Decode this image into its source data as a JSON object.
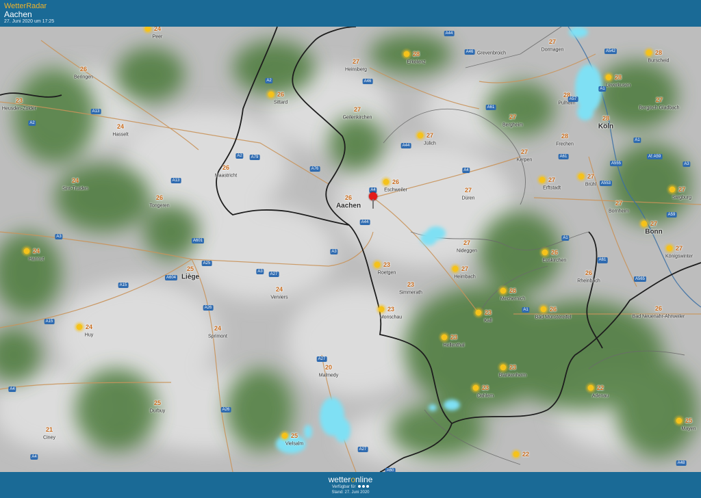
{
  "header": {
    "brand": "WetterRadar",
    "location": "Aachen",
    "timestamp": "27. Juni 2020 um 17:25"
  },
  "footer": {
    "logo_a": "wetter",
    "logo_o": "o",
    "logo_b": "nline",
    "availability": "Verfügbar für",
    "stand": "Stand: 27. Juni 2020"
  },
  "colors": {
    "bar": "#1a6a96",
    "accent": "#f1b42a",
    "forest": "#4b7a3a",
    "rain": "#7fe0f4",
    "temperature": "#c86a1a"
  },
  "places": [
    {
      "name": "Peer",
      "temp": "24",
      "sun": true
    },
    {
      "name": "Beringen",
      "temp": "26"
    },
    {
      "name": "Heusden-Zolder",
      "temp": "23"
    },
    {
      "name": "Hasselt",
      "temp": "24"
    },
    {
      "name": "Sint-Truiden",
      "temp": "24"
    },
    {
      "name": "Tongeren",
      "temp": "26"
    },
    {
      "name": "Hannut",
      "temp": "24",
      "sun": true
    },
    {
      "name": "Liège",
      "temp": "25",
      "big": true
    },
    {
      "name": "Huy",
      "temp": "24",
      "sun": true
    },
    {
      "name": "Ciney",
      "temp": "21"
    },
    {
      "name": "Durbuy",
      "temp": "25"
    },
    {
      "name": "Sprimont",
      "temp": "24"
    },
    {
      "name": "Verviers",
      "temp": "24"
    },
    {
      "name": "Maastricht",
      "temp": "26"
    },
    {
      "name": "Sittard",
      "temp": "26",
      "sun": true
    },
    {
      "name": "Heinsberg",
      "temp": "27"
    },
    {
      "name": "Geilenkirchen",
      "temp": "27"
    },
    {
      "name": "Erkelenz",
      "temp": "28",
      "sun": true
    },
    {
      "name": "Grevenbroich"
    },
    {
      "name": "Dormagen",
      "temp": "27"
    },
    {
      "name": "Leverkusen",
      "temp": "28",
      "sun": true
    },
    {
      "name": "Burscheid",
      "temp": "28",
      "sun": true
    },
    {
      "name": "Pulheim",
      "temp": "28"
    },
    {
      "name": "Bergisch Gladbach",
      "temp": "27"
    },
    {
      "name": "Köln",
      "temp": "28",
      "big": true
    },
    {
      "name": "Bergheim",
      "temp": "27"
    },
    {
      "name": "Jülich",
      "temp": "27",
      "sun": true
    },
    {
      "name": "Frechen",
      "temp": "28"
    },
    {
      "name": "Kerpen",
      "temp": "27"
    },
    {
      "name": "Eschweiler",
      "temp": "26",
      "sun": true
    },
    {
      "name": "Aachen",
      "temp": "26",
      "big": true
    },
    {
      "name": "Düren",
      "temp": "27"
    },
    {
      "name": "Erftstadt",
      "temp": "27",
      "sun": true
    },
    {
      "name": "Brühl",
      "temp": "27",
      "sun": true
    },
    {
      "name": "Siegburg",
      "temp": "27",
      "sun": true
    },
    {
      "name": "Bornheim",
      "temp": "27"
    },
    {
      "name": "Bonn",
      "temp": "27",
      "big": true,
      "sun": true
    },
    {
      "name": "Königswinter",
      "temp": "27",
      "sun": true
    },
    {
      "name": "Nideggen",
      "temp": "27"
    },
    {
      "name": "Euskirchen",
      "temp": "26",
      "sun": true
    },
    {
      "name": "Heimbach",
      "temp": "27",
      "sun": true
    },
    {
      "name": "Roetgen",
      "temp": "23",
      "sun": true
    },
    {
      "name": "Simmerath",
      "temp": "23"
    },
    {
      "name": "Monschau",
      "temp": "23",
      "sun": true
    },
    {
      "name": "Rheinbach",
      "temp": "26"
    },
    {
      "name": "Mechernich",
      "temp": "26",
      "sun": true
    },
    {
      "name": "Kall",
      "temp": "23",
      "sun": true
    },
    {
      "name": "Bad Münstereifel",
      "temp": "26",
      "sun": true
    },
    {
      "name": "Bad Neuenahr-Ahrweiler",
      "temp": "26"
    },
    {
      "name": "Hellenthal",
      "temp": "23",
      "sun": true
    },
    {
      "name": "Blankenheim",
      "temp": "23",
      "sun": true
    },
    {
      "name": "Dahlem",
      "temp": "23",
      "sun": true
    },
    {
      "name": "Adenau",
      "temp": "22",
      "sun": true
    },
    {
      "name": "Mayen",
      "temp": "25",
      "sun": true
    },
    {
      "name": "Malmedy",
      "temp": "20"
    },
    {
      "name": "Vielsalm",
      "temp": "25",
      "sun": true
    },
    {
      "name": "",
      "temp": "22",
      "sun": true
    }
  ],
  "roads": [
    "A2",
    "A13",
    "A2",
    "A13",
    "A15",
    "A3",
    "A601",
    "A25",
    "A604",
    "A15",
    "A26",
    "A26",
    "A27",
    "A4",
    "A3",
    "A27",
    "A2",
    "A79",
    "A76",
    "A44",
    "A4",
    "A44",
    "A3",
    "A27",
    "A46",
    "A61",
    "A46",
    "A44",
    "A4",
    "A61",
    "A1",
    "A57",
    "A542",
    "A1",
    "A559",
    "A59",
    "A555",
    "A553",
    "A1",
    "A61",
    "A59",
    "A3",
    "A61",
    "A565",
    "A1",
    "A48",
    "A4",
    "A60"
  ]
}
